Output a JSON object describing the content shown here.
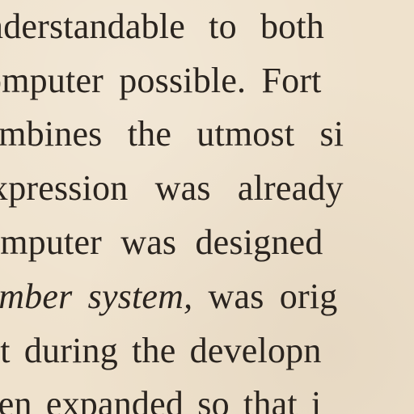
{
  "document": {
    "lines": [
      {
        "segments": [
          {
            "text": "nderstandable to both",
            "italic": false
          }
        ]
      },
      {
        "segments": [
          {
            "text": "omputer possible. Fort",
            "italic": false
          }
        ]
      },
      {
        "segments": [
          {
            "text": "ombines the utmost si",
            "italic": false
          }
        ]
      },
      {
        "segments": [
          {
            "text": "xpression was already",
            "italic": false
          }
        ]
      },
      {
        "segments": [
          {
            "text": "omputer was designed",
            "italic": false
          }
        ]
      },
      {
        "segments": [
          {
            "text": "umber system,",
            "italic": true
          },
          {
            "text": " was orig",
            "italic": false
          }
        ]
      },
      {
        "segments": [
          {
            "text": "ut during the developn",
            "italic": false
          }
        ]
      },
      {
        "segments": [
          {
            "text": "een expanded so that i",
            "italic": false
          }
        ]
      }
    ]
  }
}
